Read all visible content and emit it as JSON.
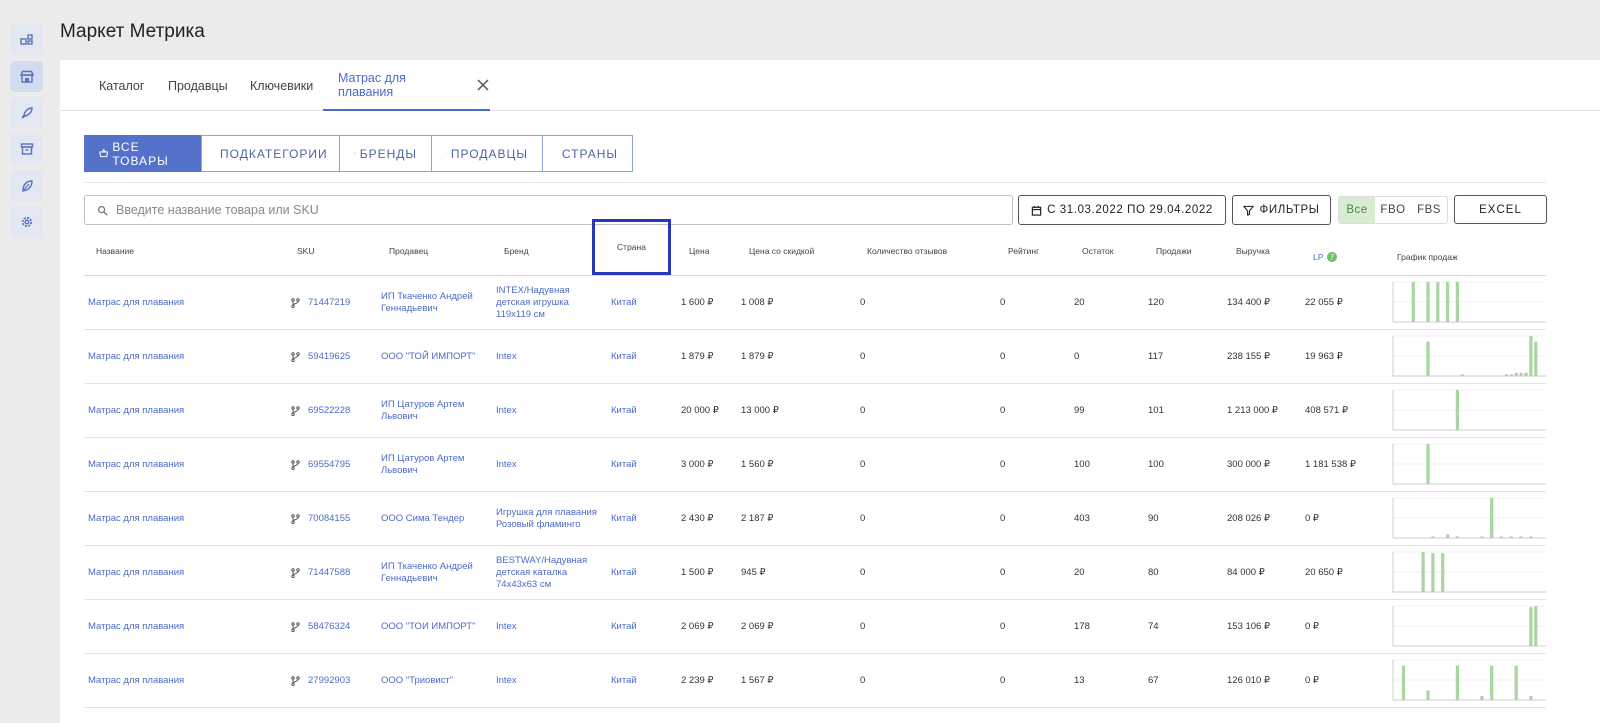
{
  "app": {
    "title": "Маркет Метрика"
  },
  "sidebar": {
    "icons": [
      "dashboard-icon",
      "store-icon",
      "rocket-icon",
      "archive-icon",
      "leaf-icon",
      "gear-icon"
    ],
    "active_index": 1
  },
  "tabs": [
    {
      "label": "Каталог"
    },
    {
      "label": "Продавцы"
    },
    {
      "label": "Ключевики"
    },
    {
      "label": "Матрас для плавания",
      "active": true,
      "closable": true
    }
  ],
  "views": [
    {
      "label": "ВСЕ ТОВАРЫ",
      "icon": "basket-icon",
      "active": true
    },
    {
      "label": "ПОДКАТЕГОРИИ",
      "icon": "list-icon"
    },
    {
      "label": "БРЕНДЫ",
      "icon": "tag-icon"
    },
    {
      "label": "ПРОДАВЦЫ",
      "icon": "users-icon"
    },
    {
      "label": "СТРАНЫ",
      "icon": "flag-icon"
    }
  ],
  "toolbar": {
    "search_placeholder": "Введите название товара или SKU",
    "search_value": "",
    "date_range": "С 31.03.2022 ПО 29.04.2022",
    "filters_label": "ФИЛЬТРЫ",
    "fulfillment": [
      "Все",
      "FBO",
      "FBS"
    ],
    "fulfillment_selected": "Все",
    "excel_label": "EXCEL"
  },
  "table": {
    "columns": {
      "name": "Название",
      "sku": "SKU",
      "seller": "Продавец",
      "brand": "Бренд",
      "country": "Страна",
      "price": "Цена",
      "discount_price": "Цена со скидкой",
      "reviews": "Количество отзывов",
      "rating": "Рейтинг",
      "stock": "Остаток",
      "sales": "Продажи",
      "revenue": "Выручка",
      "lp": "LP",
      "chart": "График продаж"
    },
    "highlighted_column": "country",
    "accent_color": "#4c6bc8",
    "chart_color": "#a8d5a0",
    "rows": [
      {
        "name": "Матрас для плавания",
        "sku": "71447219",
        "seller": "ИП Ткаченко Андрей Геннадьевич",
        "brand": "INTEX/Надувная детская игрушка 119x119 см",
        "country": "Китай",
        "price": "1 600 ₽",
        "discount_price": "1 008 ₽",
        "reviews": "0",
        "rating": "0",
        "stock": "20",
        "sales": "120",
        "revenue": "134 400 ₽",
        "lp": "22 055 ₽",
        "spark": [
          0,
          0,
          0,
          1,
          0,
          0,
          1,
          0,
          1,
          0,
          1,
          0,
          1,
          0,
          0,
          0,
          0,
          0,
          0,
          0,
          0,
          0,
          0,
          0,
          0,
          0,
          0,
          0,
          0,
          0
        ]
      },
      {
        "name": "Матрас для плавания",
        "sku": "59419625",
        "seller": "ООО \"ТОЙ ИМПОРТ\"",
        "brand": "Intex",
        "country": "Китай",
        "price": "1 879 ₽",
        "discount_price": "1 879 ₽",
        "reviews": "0",
        "rating": "0",
        "stock": "0",
        "sales": "117",
        "revenue": "238 155 ₽",
        "lp": "19 963 ₽",
        "spark": [
          0,
          0,
          0,
          0,
          0,
          0,
          0.86,
          0,
          0,
          0,
          0,
          0,
          0,
          0.04,
          0,
          0,
          0,
          0,
          0,
          0,
          0,
          0,
          0.04,
          0.04,
          0.08,
          0.08,
          0.08,
          1,
          0.86,
          0
        ]
      },
      {
        "name": "Матрас для плавания",
        "sku": "69522228",
        "seller": "ИП Цатуров Артем Львович",
        "brand": "Intex",
        "country": "Китай",
        "price": "20 000 ₽",
        "discount_price": "13 000 ₽",
        "reviews": "0",
        "rating": "0",
        "stock": "99",
        "sales": "101",
        "revenue": "1 213 000 ₽",
        "lp": "408 571 ₽",
        "spark": [
          0,
          0,
          0,
          0,
          0,
          0,
          0,
          0,
          0,
          0,
          0,
          0,
          1,
          0,
          0,
          0,
          0,
          0,
          0,
          0,
          0,
          0,
          0,
          0,
          0,
          0,
          0,
          0,
          0,
          0
        ]
      },
      {
        "name": "Матрас для плавания",
        "sku": "69554795",
        "seller": "ИП Цатуров Артем Львович",
        "brand": "Intex",
        "country": "Китай",
        "price": "3 000 ₽",
        "discount_price": "1 560 ₽",
        "reviews": "0",
        "rating": "0",
        "stock": "100",
        "sales": "100",
        "revenue": "300 000 ₽",
        "lp": "1 181 538 ₽",
        "spark": [
          0,
          0,
          0,
          0,
          0,
          0,
          1,
          0,
          0,
          0,
          0,
          0,
          0,
          0,
          0,
          0,
          0,
          0,
          0,
          0,
          0,
          0,
          0,
          0,
          0,
          0,
          0,
          0,
          0,
          0
        ]
      },
      {
        "name": "Матрас для плавания",
        "sku": "70084155",
        "seller": "ООО Сима Тендер",
        "brand": "Игрушка для плавания Розовый фламинго",
        "country": "Китай",
        "price": "2 430 ₽",
        "discount_price": "2 187 ₽",
        "reviews": "0",
        "rating": "0",
        "stock": "403",
        "sales": "90",
        "revenue": "208 026 ₽",
        "lp": "0 ₽",
        "spark": [
          0,
          0,
          0,
          0,
          0,
          0,
          0,
          0.03,
          0,
          0,
          0.09,
          0,
          0.03,
          0,
          0,
          0,
          0,
          0.03,
          0,
          1,
          0,
          0.03,
          0,
          0.03,
          0,
          0.03,
          0,
          0.03,
          0,
          0
        ]
      },
      {
        "name": "Матрас для плавания",
        "sku": "71447588",
        "seller": "ИП Ткаченко Андрей Геннадьевич",
        "brand": "BESTWAY/Надувная детская каталка 74x43x63 см",
        "country": "Китай",
        "price": "1 500 ₽",
        "discount_price": "945 ₽",
        "reviews": "0",
        "rating": "0",
        "stock": "20",
        "sales": "80",
        "revenue": "84 000 ₽",
        "lp": "20 650 ₽",
        "spark": [
          0,
          0,
          0,
          0,
          0,
          1,
          0,
          0.97,
          0,
          0.97,
          0,
          0,
          0,
          0,
          0,
          0,
          0,
          0,
          0,
          0,
          0,
          0,
          0,
          0,
          0,
          0,
          0,
          0,
          0,
          0
        ]
      },
      {
        "name": "Матрас для плавания",
        "sku": "58476324",
        "seller": "ООО \"ТОИ ИМПОРТ\"",
        "brand": "Intex",
        "country": "Китай",
        "price": "2 069 ₽",
        "discount_price": "2 069 ₽",
        "reviews": "0",
        "rating": "0",
        "stock": "178",
        "sales": "74",
        "revenue": "153 106 ₽",
        "lp": "0 ₽",
        "spark": [
          0,
          0,
          0,
          0,
          0,
          0,
          0,
          0,
          0,
          0,
          0,
          0,
          0,
          0,
          0,
          0,
          0,
          0,
          0,
          0,
          0,
          0,
          0,
          0,
          0,
          0,
          0,
          0.97,
          1,
          0
        ]
      },
      {
        "name": "Матрас для плавания",
        "sku": "27992903",
        "seller": "ООО \"Триовист\"",
        "brand": "Intex",
        "country": "Китай",
        "price": "2 239 ₽",
        "discount_price": "1 567 ₽",
        "reviews": "0",
        "rating": "0",
        "stock": "13",
        "sales": "67",
        "revenue": "126 010 ₽",
        "lp": "0 ₽",
        "spark": [
          0,
          0.86,
          0,
          0,
          0,
          0,
          0.24,
          0,
          0,
          0,
          0,
          0,
          0.86,
          0,
          0,
          0,
          0,
          0.1,
          0,
          0.86,
          0,
          0,
          0,
          0,
          0.86,
          0,
          0,
          0.1,
          0,
          0
        ]
      }
    ]
  }
}
